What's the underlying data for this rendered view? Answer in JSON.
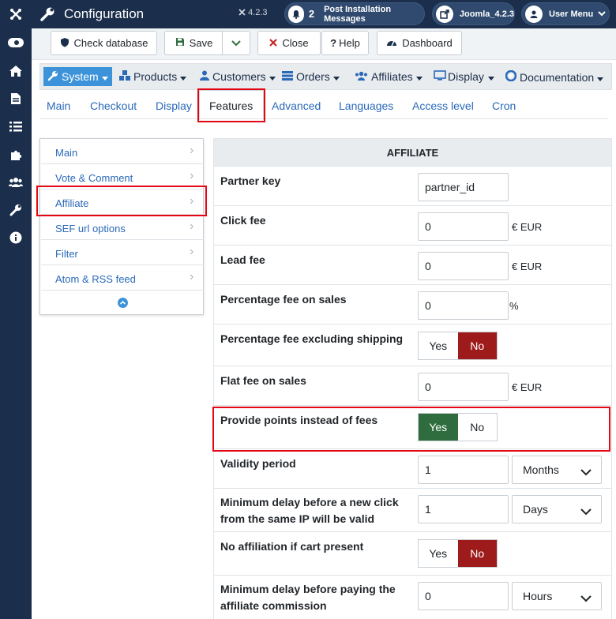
{
  "topbar": {
    "title": "Configuration",
    "version": "4.2.3",
    "notification_count": "2",
    "post_install_label": "Post Installation Messages",
    "site_label": "Joomla_4.2.3",
    "user_menu_label": "User Menu"
  },
  "toolbar": {
    "check_db": "Check database",
    "save": "Save",
    "close": "Close",
    "help": "Help",
    "dashboard": "Dashboard"
  },
  "menubar": {
    "items": [
      {
        "label": "System"
      },
      {
        "label": "Products"
      },
      {
        "label": "Customers"
      },
      {
        "label": "Orders"
      },
      {
        "label": "Affiliates"
      },
      {
        "label": "Display"
      },
      {
        "label": "Documentation"
      }
    ]
  },
  "subtabs": [
    "Main",
    "Checkout",
    "Display",
    "Features",
    "Advanced",
    "Languages",
    "Access level",
    "Cron"
  ],
  "left_menu": [
    "Main",
    "Vote & Comment",
    "Affiliate",
    "SEF url options",
    "Filter",
    "Atom & RSS feed"
  ],
  "section_title": "AFFILIATE",
  "rows": {
    "partner_key": {
      "label": "Partner key",
      "value": "partner_id"
    },
    "click_fee": {
      "label": "Click fee",
      "value": "0",
      "unit": "€ EUR"
    },
    "lead_fee": {
      "label": "Lead fee",
      "value": "0",
      "unit": "€ EUR"
    },
    "pct_fee": {
      "label": "Percentage fee on sales",
      "value": "0",
      "unit": "%"
    },
    "pct_excl": {
      "label": "Percentage fee excluding shipping",
      "yes": "Yes",
      "no": "No",
      "selected": "No"
    },
    "flat_fee": {
      "label": "Flat fee on sales",
      "value": "0",
      "unit": "€ EUR"
    },
    "points": {
      "label": "Provide points instead of fees",
      "yes": "Yes",
      "no": "No",
      "selected": "Yes"
    },
    "validity": {
      "label": "Validity period",
      "value": "1",
      "select": "Months"
    },
    "min_delay_click": {
      "label": "Minimum delay before a new click from the same IP will be valid",
      "value": "1",
      "select": "Days"
    },
    "no_aff_cart": {
      "label": "No affiliation if cart present",
      "yes": "Yes",
      "no": "No",
      "selected": "No"
    },
    "min_delay_pay": {
      "label": "Minimum delay before paying the affiliate commission",
      "value": "0",
      "select": "Hours"
    }
  },
  "colors": {
    "sidebar": "#1b2e4b",
    "link": "#2a69b8",
    "active_menu": "#3d93d9",
    "no_selected": "#9e1b1b",
    "yes_selected": "#2f6d3f",
    "highlight": "#e30613"
  }
}
